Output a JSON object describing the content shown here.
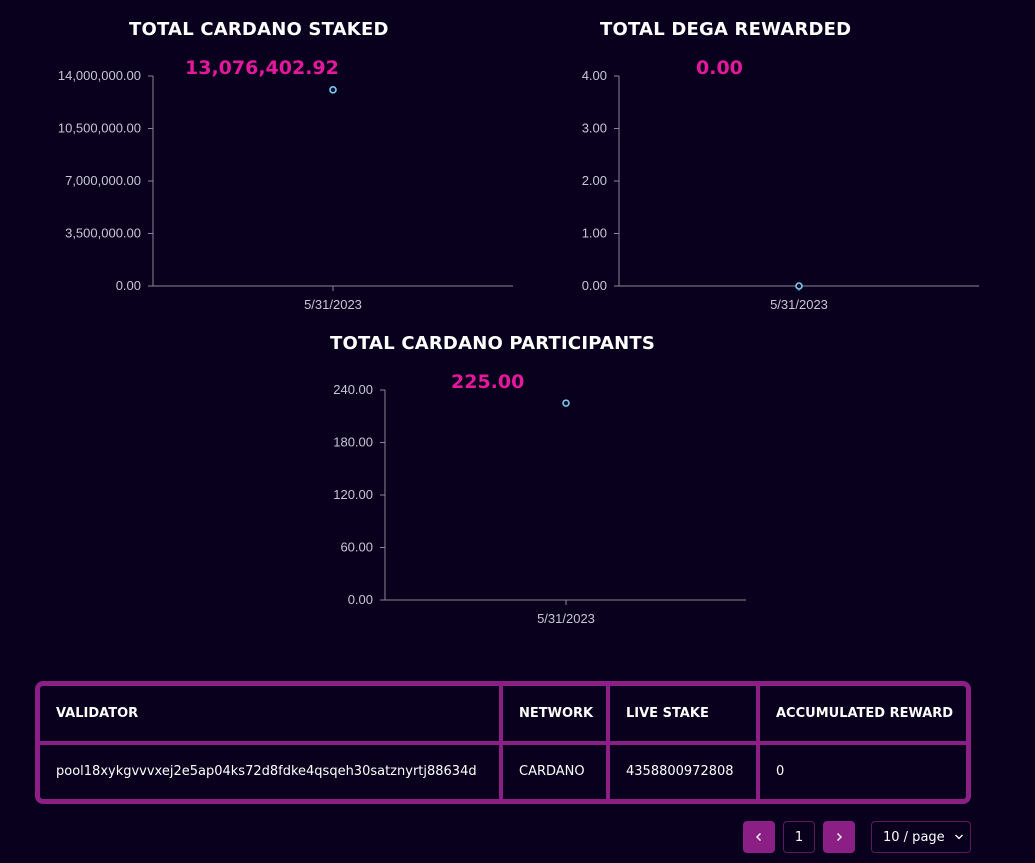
{
  "charts": [
    {
      "title": "TOTAL CARDANO STAKED",
      "value_label": "13,076,402.92",
      "chart_data": {
        "type": "scatter",
        "title": "TOTAL CARDANO STAKED",
        "categories": [
          "5/31/2023"
        ],
        "values": [
          13076402.92
        ],
        "ylim": [
          0,
          14000000
        ],
        "yticks": [
          "0.00",
          "3,500,000.00",
          "7,000,000.00",
          "10,500,000.00",
          "14,000,000.00"
        ],
        "ytick_values": [
          0,
          3500000,
          7000000,
          10500000,
          14000000
        ],
        "grid": false
      }
    },
    {
      "title": "TOTAL DEGA REWARDED",
      "value_label": "0.00",
      "chart_data": {
        "type": "scatter",
        "title": "TOTAL DEGA REWARDED",
        "categories": [
          "5/31/2023"
        ],
        "values": [
          0
        ],
        "ylim": [
          0,
          4
        ],
        "yticks": [
          "0.00",
          "1.00",
          "2.00",
          "3.00",
          "4.00"
        ],
        "ytick_values": [
          0,
          1,
          2,
          3,
          4
        ],
        "grid": false
      }
    },
    {
      "title": "TOTAL CARDANO PARTICIPANTS",
      "value_label": "225.00",
      "chart_data": {
        "type": "scatter",
        "title": "TOTAL CARDANO PARTICIPANTS",
        "categories": [
          "5/31/2023"
        ],
        "values": [
          225
        ],
        "ylim": [
          0,
          240
        ],
        "yticks": [
          "0.00",
          "60.00",
          "120.00",
          "180.00",
          "240.00"
        ],
        "ytick_values": [
          0,
          60,
          120,
          180,
          240
        ],
        "grid": false
      }
    }
  ],
  "colors": {
    "background": "#08001c",
    "accent": "#8c1f85",
    "value_pink": "#e5179c",
    "point": "#7ec8f0",
    "axis": "#8a8799"
  },
  "table": {
    "headers": [
      "VALIDATOR",
      "NETWORK",
      "LIVE STAKE",
      "ACCUMULATED REWARD"
    ],
    "rows": [
      [
        "pool18xykgvvvxej2e5ap04ks72d8fdke4qsqeh30satznyrtj88634d",
        "CARDANO",
        "4358800972808",
        "0"
      ]
    ]
  },
  "pagination": {
    "prev_icon": "chevron-left-icon",
    "next_icon": "chevron-right-icon",
    "current_page": "1",
    "page_size_label": "10 / page",
    "page_size_icon": "chevron-down-icon"
  }
}
